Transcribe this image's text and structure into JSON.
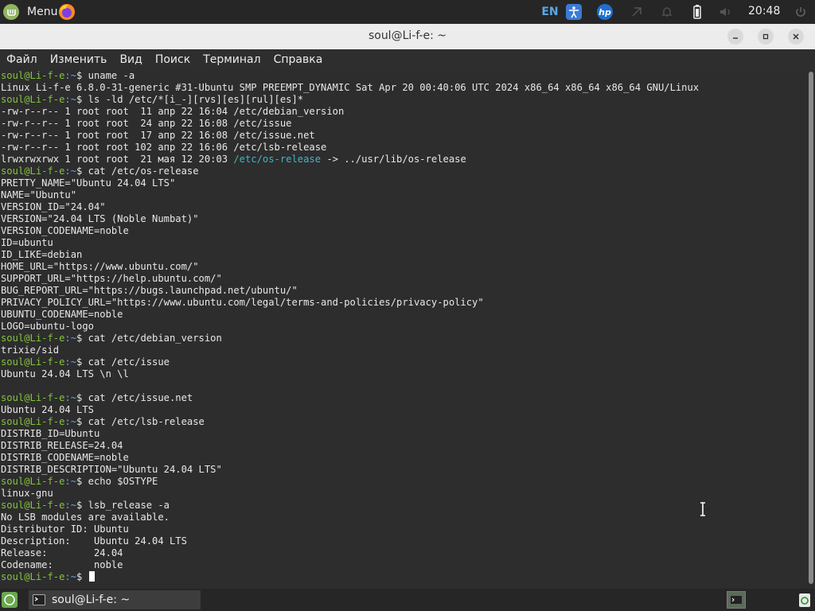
{
  "top_panel": {
    "menu_label": "Menu",
    "language": "EN",
    "clock": "20:48",
    "icons": [
      "linux-mint-logo-icon",
      "firefox-icon",
      "accessibility-icon",
      "hp-icon",
      "network-icon",
      "notifications-icon",
      "battery-icon",
      "volume-icon",
      "power-icon"
    ]
  },
  "window": {
    "title": "soul@Li-f-e: ~",
    "controls": [
      "minimize",
      "maximize",
      "close"
    ]
  },
  "menu_bar": {
    "items": [
      "Файл",
      "Изменить",
      "Вид",
      "Поиск",
      "Терминал",
      "Справка"
    ]
  },
  "terminal": {
    "user": "soul@Li-f-e",
    "path": ":~",
    "lines": [
      {
        "p": "$ ",
        "t": "uname -a"
      },
      {
        "t": "Linux Li-f-e 6.8.0-31-generic #31-Ubuntu SMP PREEMPT_DYNAMIC Sat Apr 20 00:40:06 UTC 2024 x86_64 x86_64 x86_64 GNU/Linux"
      },
      {
        "p": "$ ",
        "t": "ls -ld /etc/*[i_-][rvs][es][rul][es]*"
      },
      {
        "t": "-rw-r--r-- 1 root root  11 апр 22 16:04 /etc/debian_version"
      },
      {
        "t": "-rw-r--r-- 1 root root  24 апр 22 16:08 /etc/issue"
      },
      {
        "t": "-rw-r--r-- 1 root root  17 апр 22 16:08 /etc/issue.net"
      },
      {
        "t": "-rw-r--r-- 1 root root 102 апр 22 16:06 /etc/lsb-release"
      },
      {
        "t": "lrwxrwxrwx 1 root root  21 мая 12 20:03 ",
        "link": "/etc/os-release",
        "after": " -> ../usr/lib/os-release"
      },
      {
        "p": "$ ",
        "t": "cat /etc/os-release"
      },
      {
        "t": "PRETTY_NAME=\"Ubuntu 24.04 LTS\""
      },
      {
        "t": "NAME=\"Ubuntu\""
      },
      {
        "t": "VERSION_ID=\"24.04\""
      },
      {
        "t": "VERSION=\"24.04 LTS (Noble Numbat)\""
      },
      {
        "t": "VERSION_CODENAME=noble"
      },
      {
        "t": "ID=ubuntu"
      },
      {
        "t": "ID_LIKE=debian"
      },
      {
        "t": "HOME_URL=\"https://www.ubuntu.com/\""
      },
      {
        "t": "SUPPORT_URL=\"https://help.ubuntu.com/\""
      },
      {
        "t": "BUG_REPORT_URL=\"https://bugs.launchpad.net/ubuntu/\""
      },
      {
        "t": "PRIVACY_POLICY_URL=\"https://www.ubuntu.com/legal/terms-and-policies/privacy-policy\""
      },
      {
        "t": "UBUNTU_CODENAME=noble"
      },
      {
        "t": "LOGO=ubuntu-logo"
      },
      {
        "p": "$ ",
        "t": "cat /etc/debian_version"
      },
      {
        "t": "trixie/sid"
      },
      {
        "p": "$ ",
        "t": "cat /etc/issue"
      },
      {
        "t": "Ubuntu 24.04 LTS \\n \\l"
      },
      {
        "t": ""
      },
      {
        "p": "$ ",
        "t": "cat /etc/issue.net"
      },
      {
        "t": "Ubuntu 24.04 LTS"
      },
      {
        "p": "$ ",
        "t": "cat /etc/lsb-release"
      },
      {
        "t": "DISTRIB_ID=Ubuntu"
      },
      {
        "t": "DISTRIB_RELEASE=24.04"
      },
      {
        "t": "DISTRIB_CODENAME=noble"
      },
      {
        "t": "DISTRIB_DESCRIPTION=\"Ubuntu 24.04 LTS\""
      },
      {
        "p": "$ ",
        "t": "echo $OSTYPE"
      },
      {
        "t": "linux-gnu"
      },
      {
        "p": "$ ",
        "t": "lsb_release -a"
      },
      {
        "t": "No LSB modules are available."
      },
      {
        "t": "Distributor ID:\tUbuntu"
      },
      {
        "t": "Description:\tUbuntu 24.04 LTS"
      },
      {
        "t": "Release:\t24.04"
      },
      {
        "t": "Codename:\tnoble"
      },
      {
        "p": "$ ",
        "t": "",
        "cursor": true
      }
    ]
  },
  "taskbar": {
    "window_label": "soul@Li-f-e: ~"
  },
  "colors": {
    "prompt_user": "#84c43c",
    "prompt_path": "#5fa8e0",
    "symlink": "#3fb7c8",
    "terminal_bg": "#2d2d2d"
  }
}
